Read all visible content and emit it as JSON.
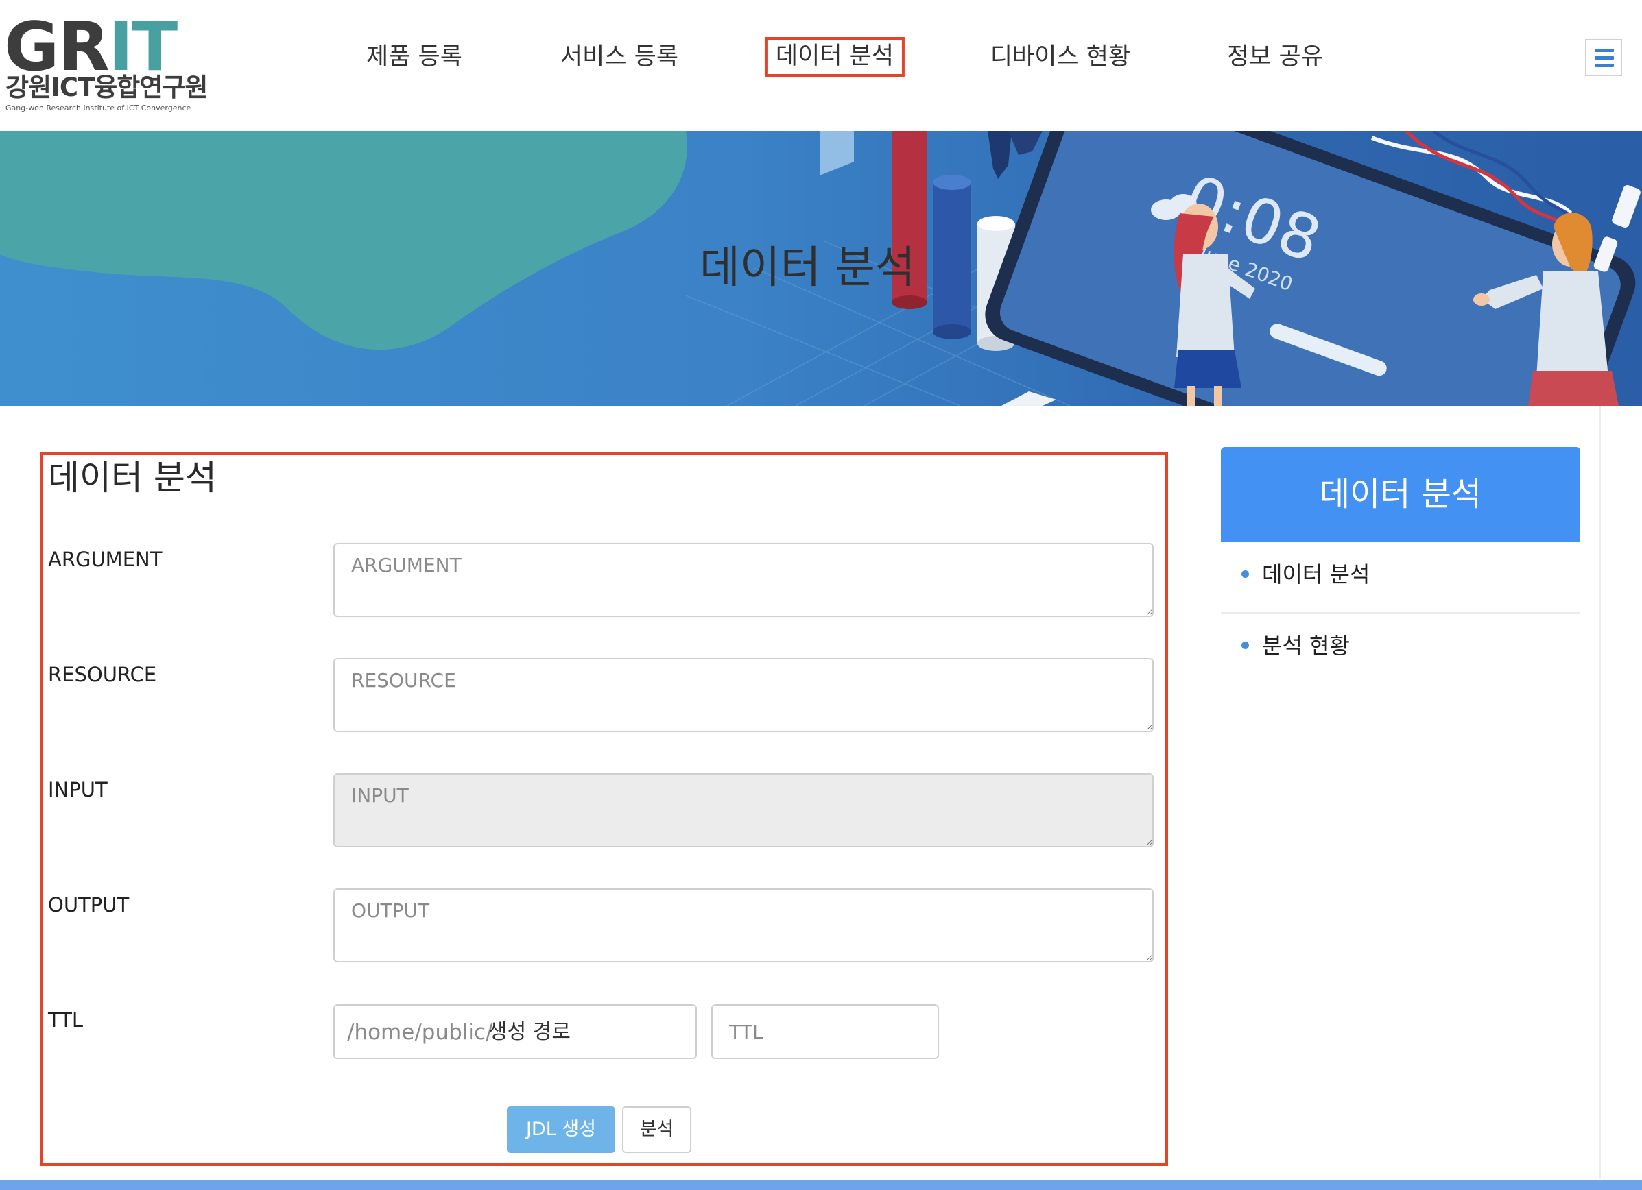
{
  "header": {
    "logo": {
      "main_dark": "GR",
      "main_accent": "IT",
      "korean": "강원ICT융합연구원",
      "english": "Gang-won Research Institute of ICT Convergence"
    },
    "nav": [
      {
        "label": "제품 등록"
      },
      {
        "label": "서비스 등록"
      },
      {
        "label": "데이터 분석",
        "active": true
      },
      {
        "label": "디바이스 현황"
      },
      {
        "label": "정보 공유"
      }
    ],
    "menu_icon": "hamburger-icon"
  },
  "banner": {
    "title": "데이터 분석",
    "clock_time": "0:08",
    "clock_date": "2 June 2020"
  },
  "form": {
    "title": "데이터 분석",
    "fields": {
      "argument": {
        "label": "ARGUMENT",
        "placeholder": "ARGUMENT",
        "value": ""
      },
      "resource": {
        "label": "RESOURCE",
        "placeholder": "RESOURCE",
        "value": ""
      },
      "input": {
        "label": "INPUT",
        "placeholder": "INPUT",
        "value": "",
        "disabled": true
      },
      "output": {
        "label": "OUTPUT",
        "placeholder": "OUTPUT",
        "value": ""
      },
      "ttl": {
        "label": "TTL",
        "path_prefix": "/home/public/",
        "path_placeholder": "생성 경로",
        "ttl_placeholder": "TTL"
      }
    },
    "buttons": {
      "jdl": "JDL 생성",
      "analyze": "분석"
    }
  },
  "sidebar": {
    "title": "데이터 분석",
    "items": [
      {
        "label": "데이터 분석"
      },
      {
        "label": "분석 현황"
      }
    ]
  },
  "colors": {
    "accent_blue": "#4391f2",
    "primary_button": "#6eb4e8",
    "highlight_red": "#e2452b",
    "banner_blue": "#3b82c6",
    "banner_teal": "#4aa3a8"
  }
}
